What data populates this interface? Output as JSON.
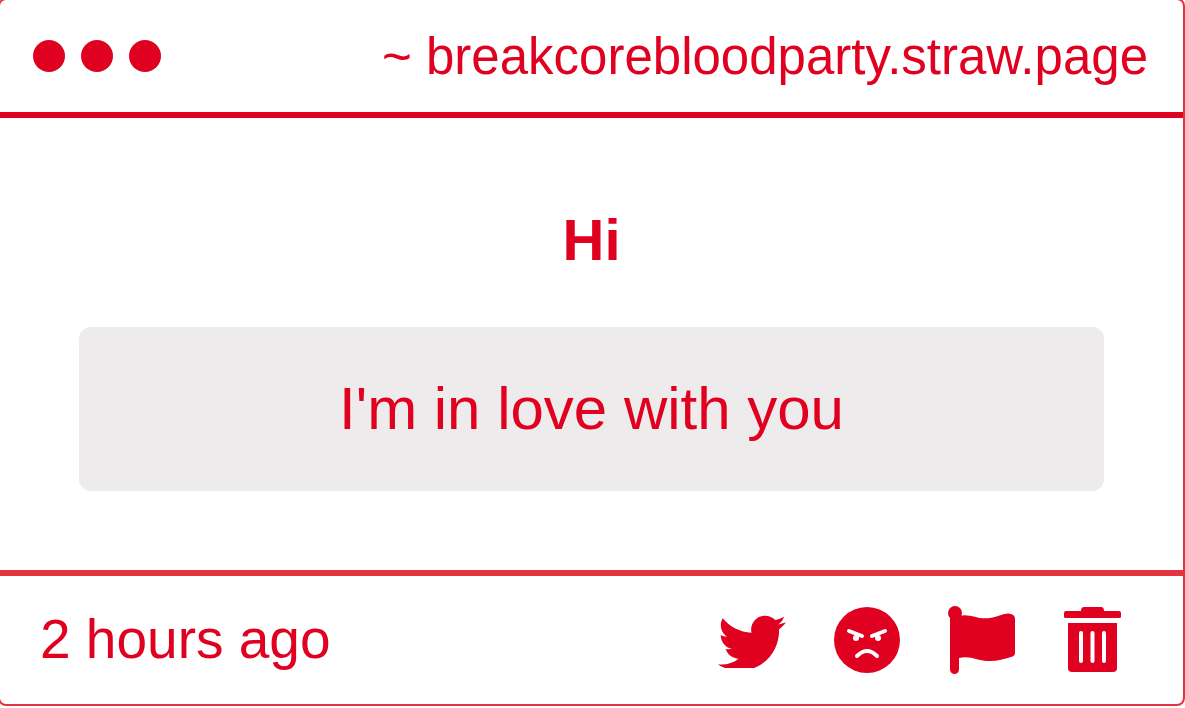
{
  "window": {
    "url": "~ breakcorebloodparty.straw.page"
  },
  "title": "Hi",
  "message": "I'm in love with you",
  "footer": {
    "time": "2 hours ago"
  }
}
